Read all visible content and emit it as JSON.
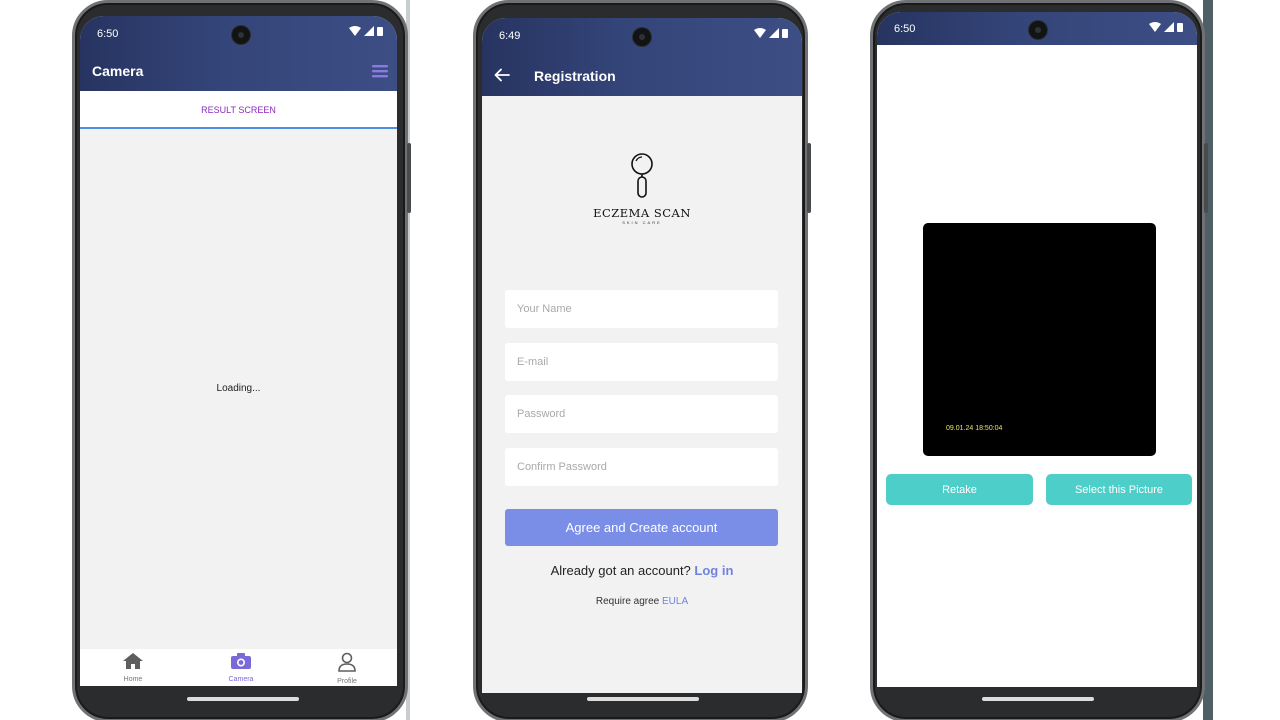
{
  "colors": {
    "appbar_gradient": [
      "#273461",
      "#3d4e85"
    ],
    "tab_label": "#8a2bbf",
    "tab_indicator": "#4d8fe3",
    "primary_button": "#7a8ee7",
    "link": "#6f83de",
    "camera_buttons": "#4ecec8",
    "nav_active": "#7a6ad8",
    "menu_icon": "#8a7be0"
  },
  "phone_camera": {
    "status_time": "6:50",
    "title": "Camera",
    "menu_icon": "hamburger-menu-icon",
    "tab_label": "RESULT SCREEN",
    "loading_text": "Loading...",
    "nav": [
      {
        "label": "Home",
        "icon": "home-icon",
        "active": false
      },
      {
        "label": "Camera",
        "icon": "camera-icon",
        "active": true
      },
      {
        "label": "Profile",
        "icon": "person-icon",
        "active": false
      }
    ]
  },
  "phone_registration": {
    "status_time": "6:49",
    "title": "Registration",
    "back_icon": "arrow-back-icon",
    "logo": {
      "brand": "ECZEMA SCAN",
      "tagline": "SKIN CARE",
      "icon": "magnifier-icon"
    },
    "fields": {
      "name_placeholder": "Your Name",
      "email_placeholder": "E-mail",
      "password_placeholder": "Password",
      "confirm_placeholder": "Confirm Password"
    },
    "primary_button": "Agree and Create account",
    "login_prompt": "Already got an account?",
    "login_link": "Log in",
    "eula_prompt": "Require agree",
    "eula_link": "EULA"
  },
  "phone_preview": {
    "status_time": "6:50",
    "timestamp": "09.01.24 18:50:04",
    "retake_button": "Retake",
    "select_button": "Select this Picture"
  }
}
